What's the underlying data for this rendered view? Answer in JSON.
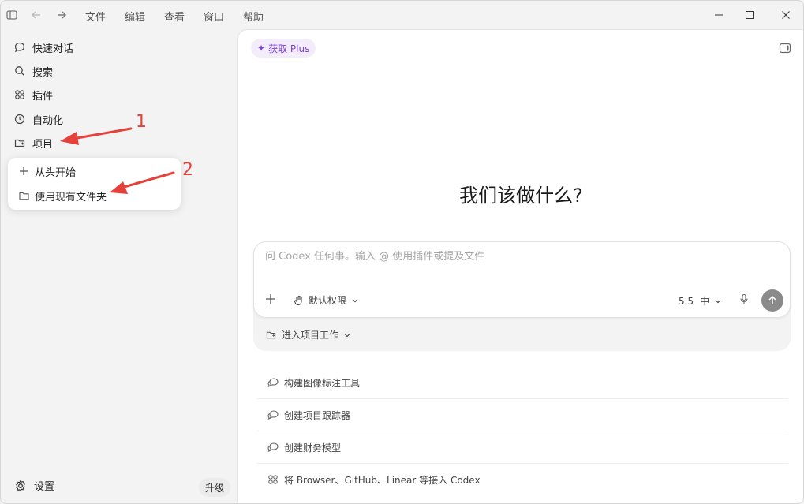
{
  "menu": {
    "file": "文件",
    "edit": "编辑",
    "view": "查看",
    "window": "窗口",
    "help": "帮助"
  },
  "sidebar": {
    "items": [
      {
        "label": "快速对话",
        "icon": "chat-bubble-icon"
      },
      {
        "label": "搜索",
        "icon": "search-icon"
      },
      {
        "label": "插件",
        "icon": "plugins-icon"
      },
      {
        "label": "自动化",
        "icon": "clock-icon"
      },
      {
        "label": "项目",
        "icon": "folder-add-icon"
      }
    ],
    "settings_label": "设置",
    "upgrade_label": "升级"
  },
  "project_menu": {
    "items": [
      {
        "label": "从头开始",
        "icon": "plus-icon"
      },
      {
        "label": "使用现有文件夹",
        "icon": "folder-icon"
      }
    ]
  },
  "main": {
    "plus_badge": "获取 Plus",
    "headline": "我们该做什么?",
    "composer": {
      "placeholder": "问 Codex 任何事。输入 @ 使用插件或提及文件",
      "permission_label": "默认权限",
      "model_label": "5.5",
      "effort_label": "中"
    },
    "project_select": "进入项目工作",
    "suggestions": [
      {
        "label": "构建图像标注工具",
        "icon": "chat-suggestion-icon"
      },
      {
        "label": "创建项目跟踪器",
        "icon": "chat-suggestion-icon"
      },
      {
        "label": "创建财务模型",
        "icon": "chat-suggestion-icon"
      },
      {
        "label": "将 Browser、GitHub、Linear 等接入 Codex",
        "icon": "plugins-icon"
      }
    ]
  },
  "annotations": {
    "step1": "1",
    "step2": "2",
    "color": "#e5403a"
  },
  "colors": {
    "accent_purple": "#7b3fd2",
    "badge_bg": "#f2ecfb",
    "send_button": "#8a8a8a"
  }
}
